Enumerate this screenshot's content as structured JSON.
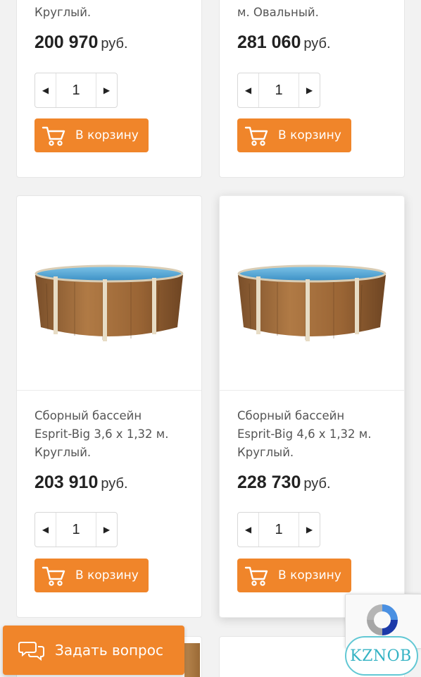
{
  "products": [
    {
      "title_tail": "Круглый.",
      "price": "200 970",
      "currency": "руб.",
      "qty": "1",
      "cart_label": "В корзину"
    },
    {
      "title_tail": "м. Овальный.",
      "price": "281 060",
      "currency": "руб.",
      "qty": "1",
      "cart_label": "В корзину"
    },
    {
      "title": [
        "Сборный бассейн",
        "Esprit-Big 3,6 x 1,32 м.",
        "Круглый."
      ],
      "price": "203 910",
      "currency": "руб.",
      "qty": "1",
      "cart_label": "В корзину"
    },
    {
      "title": [
        "Сборный бассейн",
        "Esprit-Big 4,6 x 1,32 м.",
        "Круглый."
      ],
      "price": "228 730",
      "currency": "руб.",
      "qty": "1",
      "cart_label": "В корзину"
    }
  ],
  "ask_button": {
    "label": "Задать вопрос"
  },
  "watermark": {
    "text": "KZNOB"
  },
  "icons": {
    "minus": "triangle-left-icon",
    "plus": "triangle-right-icon",
    "cart": "shopping-cart-icon",
    "chat": "chat-bubbles-icon",
    "recaptcha": "recaptcha-icon"
  },
  "colors": {
    "accent": "#f0852a",
    "watermark": "#35b3c4"
  }
}
